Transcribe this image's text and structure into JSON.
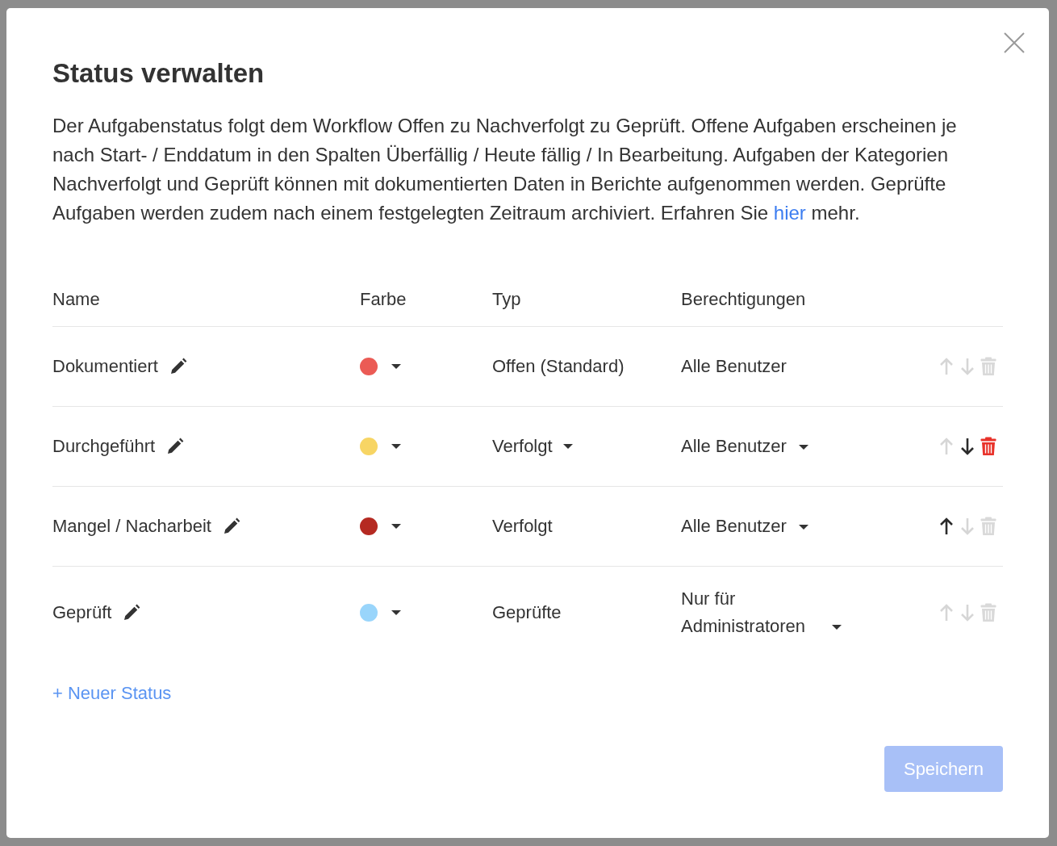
{
  "dialog": {
    "title": "Status verwalten",
    "description": "Der Aufgabenstatus folgt dem Workflow Offen zu Nachverfolgt zu Geprüft. Offene Aufgaben erscheinen je nach Start- / Enddatum in den Spalten Überfällig / Heute fällig / In Bearbeitung. Aufgaben der Kategorien Nachverfolgt und Geprüft können mit dokumentierten Daten in Berichte aufgenommen werden. Geprüfte Aufgaben werden zudem nach einem festgelegten Zeitraum archiviert. Erfahren Sie",
    "link": "hier",
    "description_end": "mehr.",
    "columns": [
      "Name",
      "Farbe",
      "Typ",
      "Berechtigungen"
    ],
    "rows": [
      {
        "name": "Dokumentiert",
        "color": "#eb5b55",
        "type": "Offen (Standard)",
        "type_dropdown": false,
        "permission": "Alle Benutzer",
        "permission_dropdown": false,
        "can_move_up": false,
        "can_move_down": false,
        "deletable": false
      },
      {
        "name": "Durchgeführt",
        "color": "#f7d564",
        "type": "Verfolgt",
        "type_dropdown": true,
        "permission": "Alle Benutzer",
        "permission_dropdown": true,
        "can_move_up": false,
        "can_move_down": true,
        "deletable": true
      },
      {
        "name": "Mangel / Nacharbeit",
        "color": "#b52a22",
        "type": "Verfolgt",
        "type_dropdown": false,
        "permission": "Alle Benutzer",
        "permission_dropdown": true,
        "can_move_up": true,
        "can_move_down": false,
        "deletable": false
      },
      {
        "name": "Geprüft",
        "color": "#99d5fb",
        "type": "Geprüfte",
        "type_dropdown": false,
        "permission": "Nur für Administratoren",
        "permission_dropdown": true,
        "can_move_up": false,
        "can_move_down": false,
        "deletable": false
      }
    ],
    "add_button": "+ Neuer Status",
    "save_button": "Speichern"
  }
}
